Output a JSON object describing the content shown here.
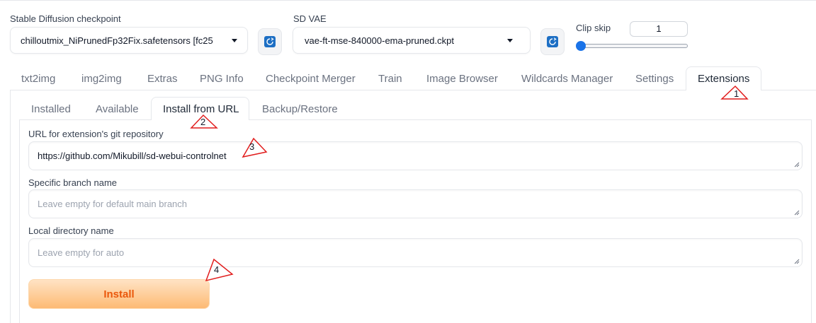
{
  "header": {
    "checkpoint": {
      "label": "Stable Diffusion checkpoint",
      "value": "chilloutmix_NiPrunedFp32Fix.safetensors [fc25"
    },
    "vae": {
      "label": "SD VAE",
      "value": "vae-ft-mse-840000-ema-pruned.ckpt"
    },
    "clip_skip": {
      "label": "Clip skip",
      "value": "1",
      "slider_fraction": 0.0
    }
  },
  "main_tabs": [
    "txt2img",
    "img2img",
    "Extras",
    "PNG Info",
    "Checkpoint Merger",
    "Train",
    "Image Browser",
    "Wildcards Manager",
    "Settings",
    "Extensions"
  ],
  "sub_tabs": [
    "Installed",
    "Available",
    "Install from URL",
    "Backup/Restore"
  ],
  "form": {
    "url_label": "URL for extension's git repository",
    "url_value": "https://github.com/Mikubill/sd-webui-controlnet",
    "branch_label": "Specific branch name",
    "branch_placeholder": "Leave empty for default main branch",
    "dir_label": "Local directory name",
    "dir_placeholder": "Leave empty for auto",
    "install_label": "Install"
  },
  "annotations": [
    "1",
    "2",
    "3",
    "4"
  ],
  "colors": {
    "accent": "#1a73e8",
    "install_text": "#ea580c",
    "annotation": "#e11d1d"
  }
}
